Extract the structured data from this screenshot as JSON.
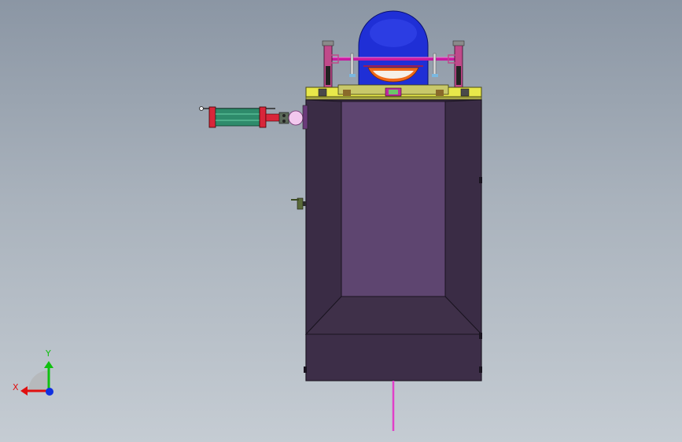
{
  "viewport": {
    "background_top": "#8b96a4",
    "background_bottom": "#c5ccd3"
  },
  "model": {
    "tank_dark_color": "#3d2e48",
    "tank_inner_color": "#5e4570",
    "tank_edge_color": "#1a1420",
    "dome_color": "#1f2fd6",
    "top_plate_color": "#e8e84a",
    "cylinder_body_color": "#2e8b6b",
    "cylinder_end_color": "#d8263a",
    "probe_color": "#e040c8"
  },
  "triad": {
    "x_label": "X",
    "y_label": "Y",
    "x_color": "#e01010",
    "y_color": "#10c010",
    "z_color": "#1030e0"
  }
}
